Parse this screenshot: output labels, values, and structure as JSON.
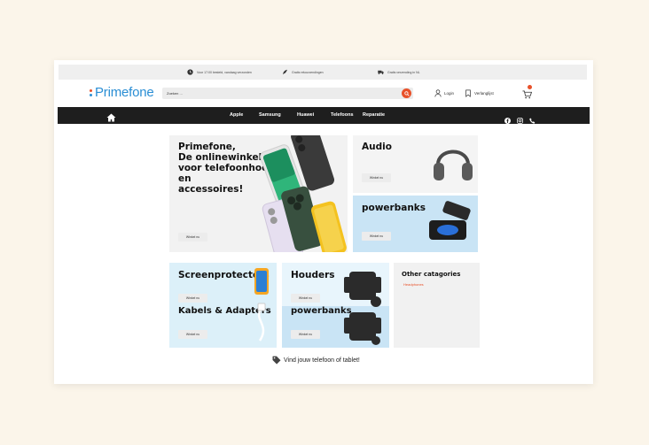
{
  "topbar": {
    "items": [
      {
        "icon": "clock-icon",
        "text": "Voor 17:00 besteld, vandaag verzonden"
      },
      {
        "icon": "feather-icon",
        "text": "Gratis retourzendingen"
      },
      {
        "icon": "truck-icon",
        "text": "Gratis verzending in NL"
      }
    ]
  },
  "header": {
    "logo": "Primefone",
    "search_placeholder": "Zoeken ...",
    "login": "Login",
    "wishlist": "Verlanglijst",
    "cart_icon": "cart-icon"
  },
  "nav": {
    "items": [
      "Apple",
      "Samsung",
      "Huawei",
      "Telefoons",
      "Reparatie"
    ],
    "social": [
      "facebook-icon",
      "instagram-icon",
      "phone-icon"
    ]
  },
  "tiles": {
    "hero": {
      "title": "Primefone,\nDe onlinewinkel\nvoor telefoonhoesjes en\naccessoires!",
      "button": "Winkel nu"
    },
    "audio": {
      "title": "Audio",
      "button": "Winkel nu"
    },
    "powerbanks_top": {
      "title": "powerbanks",
      "button": "Winkel nu"
    },
    "screenprotectors": {
      "title": "Screenprotectors",
      "button": "Winkel nu"
    },
    "kabels": {
      "title": "Kabels & Adapters",
      "button": "Winkel nu"
    },
    "houders": {
      "title": "Houders",
      "button": "Winkel nu"
    },
    "powerbanks_bottom": {
      "title": "powerbanks",
      "button": "Winkel nu"
    },
    "other": {
      "title": "Other catagories",
      "link": "Headphones"
    }
  },
  "footer": {
    "text": "Vind jouw telefoon of tablet!"
  },
  "colors": {
    "accent": "#e8512a",
    "brand": "#2a8ed4",
    "nav_bg": "#1e1e1e",
    "tile_blue": "#d9eef8",
    "tile_gray": "#f1f1f1"
  }
}
